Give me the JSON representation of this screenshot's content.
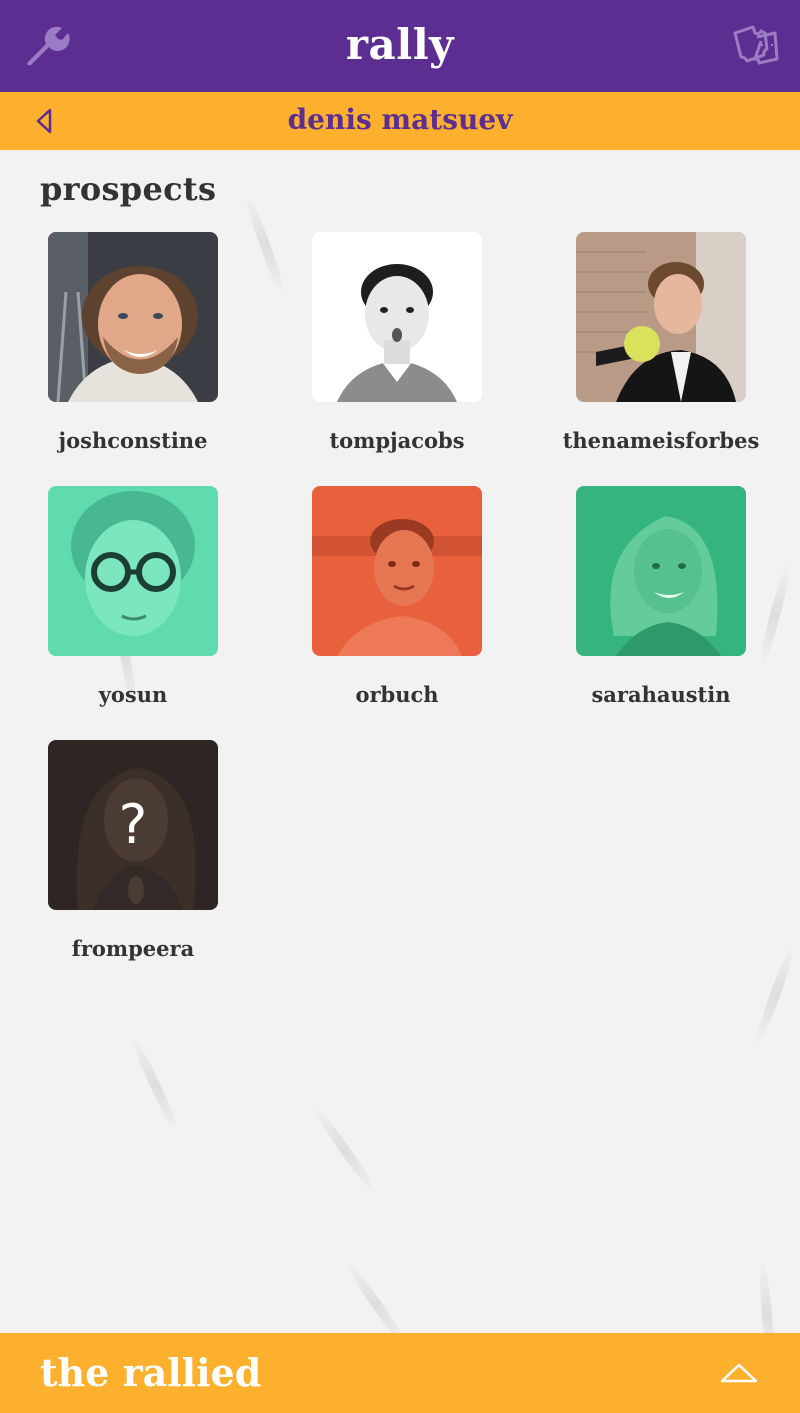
{
  "app": {
    "title": "rally",
    "settings_icon": "wrench-icon",
    "tickets_icon": "ticket-icon"
  },
  "subheader": {
    "back_icon": "back-arrow-icon",
    "name": "denis matsuev"
  },
  "prospects": {
    "title": "prospects",
    "items": [
      {
        "username": "joshconstine",
        "tint": "none"
      },
      {
        "username": "tompjacobs",
        "tint": "none"
      },
      {
        "username": "thenameisforbes",
        "tint": "none"
      },
      {
        "username": "yosun",
        "tint": "#5fdbae"
      },
      {
        "username": "orbuch",
        "tint": "#e8603c"
      },
      {
        "username": "sarahaustin",
        "tint": "#36b47f"
      },
      {
        "username": "frompeera",
        "tint": "#3b2f2a",
        "overlay": "?"
      }
    ]
  },
  "footer": {
    "label": "the rallied",
    "expand_icon": "chevron-up-icon"
  },
  "colors": {
    "header_purple": "#5d2e91",
    "accent_orange": "#fdb02d",
    "background": "#f2f2f2",
    "text_dark": "#333333"
  }
}
